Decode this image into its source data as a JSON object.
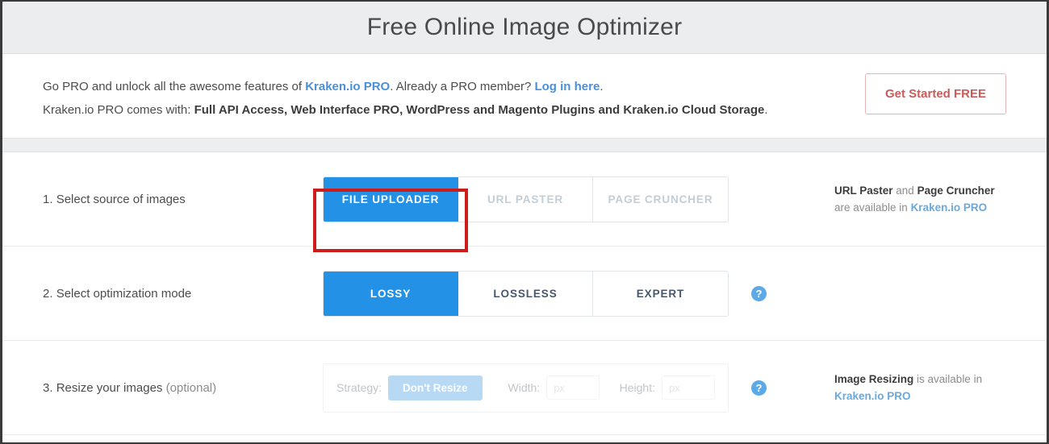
{
  "header": {
    "title": "Free Online Image Optimizer"
  },
  "banner": {
    "line1": {
      "part1": "Go PRO and unlock all the awesome features of ",
      "link1": "Kraken.io PRO",
      "part2": ". Already a PRO member? ",
      "link2": "Log in here",
      "part3": "."
    },
    "line2": {
      "part1": "Kraken.io PRO comes with: ",
      "bold1": "Full API Access, Web Interface PRO, WordPress and Magento Plugins and Kraken.io Cloud Storage",
      "part2": "."
    },
    "cta_label": "Get Started FREE"
  },
  "steps": [
    {
      "label_number": "1. ",
      "label_text": "Select source of images",
      "options": [
        {
          "label": "FILE UPLOADER",
          "state": "active"
        },
        {
          "label": "URL PASTER",
          "state": "disabled"
        },
        {
          "label": "PAGE CRUNCHER",
          "state": "disabled"
        }
      ],
      "side_note": {
        "bold1": "URL Paster",
        "mid1": " and ",
        "bold2": "Page Cruncher",
        "line2_text": "are available in ",
        "line2_link": "Kraken.io PRO"
      }
    },
    {
      "label_number": "2. ",
      "label_text": "Select optimization mode",
      "options": [
        {
          "label": "LOSSY",
          "state": "active"
        },
        {
          "label": "LOSSLESS",
          "state": "normal"
        },
        {
          "label": "EXPERT",
          "state": "normal"
        }
      ],
      "help_glyph": "?"
    },
    {
      "label_number": "3. ",
      "label_text": "Resize your images ",
      "label_optional": "(optional)",
      "strategy_label": "Strategy:",
      "strategy_value": "Don't Resize",
      "width_label": "Width:",
      "width_value": "",
      "width_placeholder": "px",
      "height_label": "Height:",
      "height_value": "",
      "height_placeholder": "px",
      "help_glyph": "?",
      "side_note": {
        "bold1": "Image Resizing",
        "mid1": " is available in",
        "line2_link": "Kraken.io PRO"
      }
    }
  ],
  "colors": {
    "accent_blue": "#2391e6",
    "link_blue": "#6aa9dd",
    "cta_red": "#cc5a5a",
    "highlight_red": "#cc1c1c",
    "header_grey": "#ebedee"
  },
  "annotation": {
    "highlight_target": "FILE UPLOADER"
  }
}
